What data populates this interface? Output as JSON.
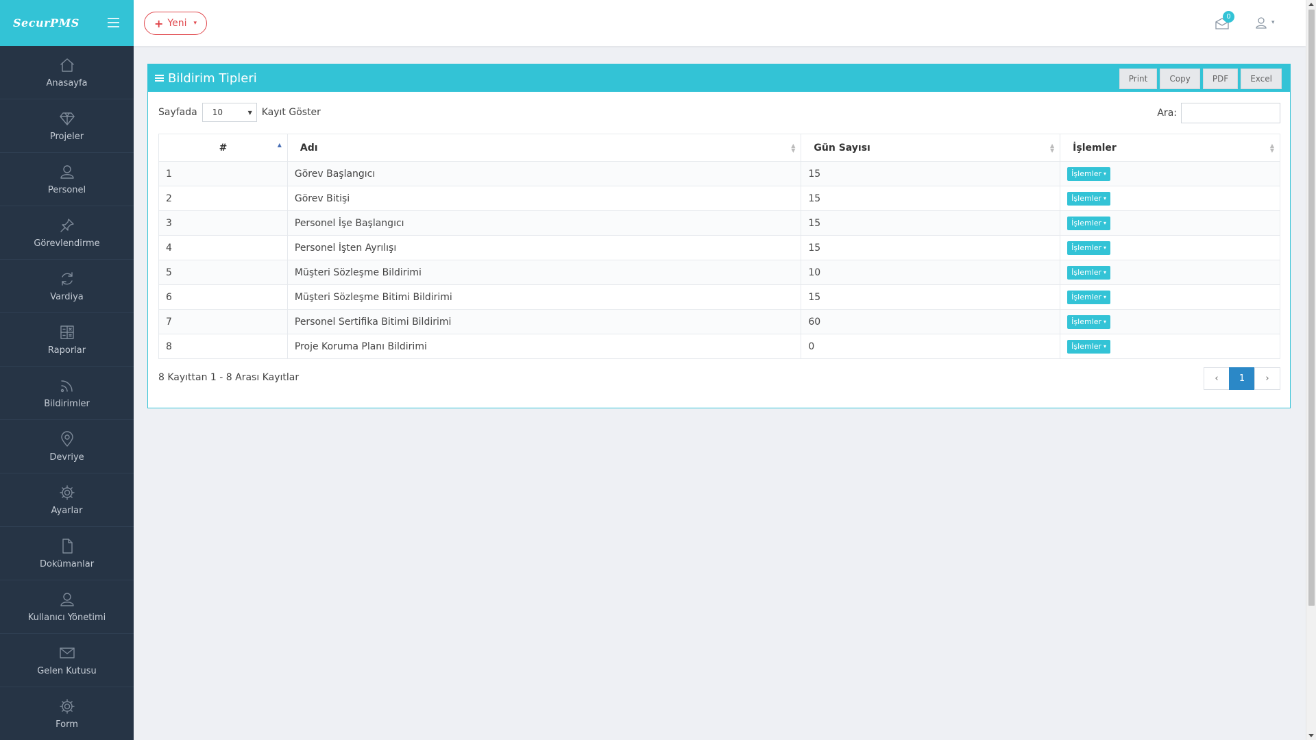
{
  "app": {
    "brand": "SecurPMS"
  },
  "topbar": {
    "new_label": "Yeni",
    "notification_count": "0"
  },
  "sidebar": {
    "items": [
      {
        "label": "Anasayfa",
        "icon": "home-icon"
      },
      {
        "label": "Projeler",
        "icon": "diamond-icon"
      },
      {
        "label": "Personel",
        "icon": "user-icon"
      },
      {
        "label": "Görevlendirme",
        "icon": "pin-icon"
      },
      {
        "label": "Vardiya",
        "icon": "refresh-icon"
      },
      {
        "label": "Raporlar",
        "icon": "calculator-icon"
      },
      {
        "label": "Bildirimler",
        "icon": "rss-icon"
      },
      {
        "label": "Devriye",
        "icon": "map-marker-icon"
      },
      {
        "label": "Ayarlar",
        "icon": "gear-icon"
      },
      {
        "label": "Dokümanlar",
        "icon": "document-icon"
      },
      {
        "label": "Kullanıcı Yönetimi",
        "icon": "user-icon"
      },
      {
        "label": "Gelen Kutusu",
        "icon": "envelope-icon"
      },
      {
        "label": "Form",
        "icon": "gear-icon"
      }
    ]
  },
  "panel": {
    "title": "Bildirim Tipleri",
    "export_buttons": [
      "Print",
      "Copy",
      "PDF",
      "Excel"
    ],
    "length_prefix": "Sayfada",
    "length_value": "10",
    "length_suffix": "Kayıt Göster",
    "search_label": "Ara:",
    "search_value": ""
  },
  "table": {
    "columns": [
      "#",
      "Adı",
      "Gün Sayısı",
      "İşlemler"
    ],
    "action_label": "İşlemler",
    "rows": [
      {
        "id": "1",
        "name": "Görev Başlangıcı",
        "days": "15"
      },
      {
        "id": "2",
        "name": "Görev Bitişi",
        "days": "15"
      },
      {
        "id": "3",
        "name": "Personel İşe Başlangıcı",
        "days": "15"
      },
      {
        "id": "4",
        "name": "Personel İşten Ayrılışı",
        "days": "15"
      },
      {
        "id": "5",
        "name": "Müşteri Sözleşme Bildirimi",
        "days": "10"
      },
      {
        "id": "6",
        "name": "Müşteri Sözleşme Bitimi Bildirimi",
        "days": "15"
      },
      {
        "id": "7",
        "name": "Personel Sertifika Bitimi Bildirimi",
        "days": "60"
      },
      {
        "id": "8",
        "name": "Proje Koruma Planı Bildirimi",
        "days": "0"
      }
    ]
  },
  "footer": {
    "info": "8 Kayıttan 1 - 8 Arası Kayıtlar",
    "prev": "‹",
    "current_page": "1",
    "next": "›"
  },
  "colors": {
    "accent": "#33c3d6",
    "sidebar": "#263445",
    "danger": "#e0464b",
    "page_active": "#2b88c7"
  }
}
